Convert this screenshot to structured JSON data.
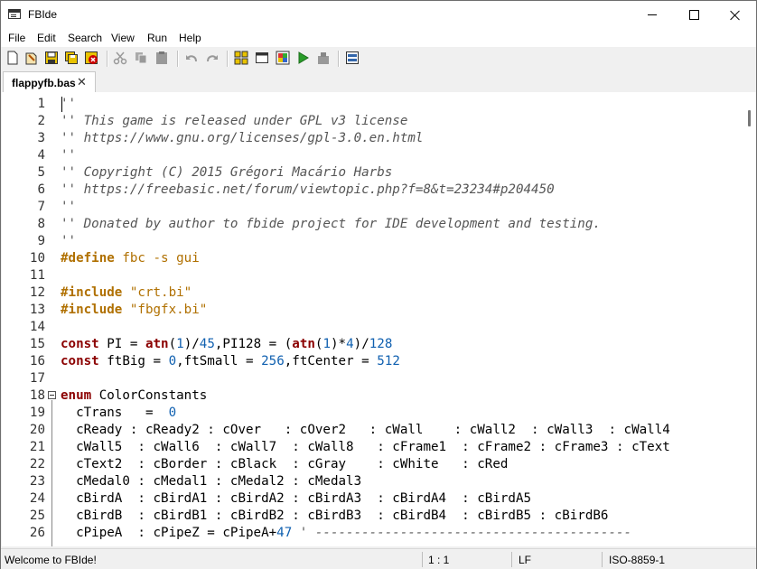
{
  "window": {
    "title": "FBIde"
  },
  "menu": [
    "File",
    "Edit",
    "Search",
    "View",
    "Run",
    "Help"
  ],
  "toolbar": {
    "buttons": [
      {
        "name": "new-file-icon"
      },
      {
        "name": "open-file-icon"
      },
      {
        "name": "save-icon"
      },
      {
        "name": "save-all-icon"
      },
      {
        "name": "close-file-icon"
      },
      {
        "name": "cut-icon"
      },
      {
        "name": "copy-icon"
      },
      {
        "name": "paste-icon"
      },
      {
        "name": "undo-icon"
      },
      {
        "name": "redo-icon"
      },
      {
        "name": "compile-icon"
      },
      {
        "name": "window-icon"
      },
      {
        "name": "compile-run-icon"
      },
      {
        "name": "run-icon"
      },
      {
        "name": "quick-run-icon"
      },
      {
        "name": "output-icon"
      }
    ]
  },
  "tab": {
    "label": "flappyfb.bas",
    "close": "✕"
  },
  "editor": {
    "line_numbers": [
      "1",
      "2",
      "3",
      "4",
      "5",
      "6",
      "7",
      "8",
      "9",
      "10",
      "11",
      "12",
      "13",
      "14",
      "15",
      "16",
      "17",
      "18",
      "19",
      "20",
      "21",
      "22",
      "23",
      "24",
      "25",
      "26"
    ],
    "lines": [
      [
        {
          "t": "cm",
          "v": "''"
        }
      ],
      [
        {
          "t": "cm",
          "v": "'' This game is released under GPL v3 license"
        }
      ],
      [
        {
          "t": "cm",
          "v": "'' https://www.gnu.org/licenses/gpl-3.0.en.html"
        }
      ],
      [
        {
          "t": "cm",
          "v": "''"
        }
      ],
      [
        {
          "t": "cm",
          "v": "'' Copyright (C) 2015 Grégori Macário Harbs"
        }
      ],
      [
        {
          "t": "cm",
          "v": "'' https://freebasic.net/forum/viewtopic.php?f=8&t=23234#p204450"
        }
      ],
      [
        {
          "t": "cm",
          "v": "''"
        }
      ],
      [
        {
          "t": "cm",
          "v": "'' Donated by author to fbide project for IDE development and testing."
        }
      ],
      [
        {
          "t": "cm",
          "v": "''"
        }
      ],
      [
        {
          "t": "pp",
          "v": "#define"
        },
        {
          "t": "ppa",
          "v": " fbc -s gui"
        }
      ],
      [],
      [
        {
          "t": "pp",
          "v": "#include"
        },
        {
          "t": "ppa",
          "v": " "
        },
        {
          "t": "str",
          "v": "\"crt.bi\""
        }
      ],
      [
        {
          "t": "pp",
          "v": "#include"
        },
        {
          "t": "ppa",
          "v": " "
        },
        {
          "t": "str",
          "v": "\"fbgfx.bi\""
        }
      ],
      [],
      [
        {
          "t": "kw",
          "v": "const"
        },
        {
          "t": "",
          "v": " PI = "
        },
        {
          "t": "kw",
          "v": "atn"
        },
        {
          "t": "",
          "v": "("
        },
        {
          "t": "num",
          "v": "1"
        },
        {
          "t": "",
          "v": ")/"
        },
        {
          "t": "num",
          "v": "45"
        },
        {
          "t": "",
          "v": ",PI128 = ("
        },
        {
          "t": "kw",
          "v": "atn"
        },
        {
          "t": "",
          "v": "("
        },
        {
          "t": "num",
          "v": "1"
        },
        {
          "t": "",
          "v": ")*"
        },
        {
          "t": "num",
          "v": "4"
        },
        {
          "t": "",
          "v": ")/"
        },
        {
          "t": "num",
          "v": "128"
        }
      ],
      [
        {
          "t": "kw",
          "v": "const"
        },
        {
          "t": "",
          "v": " ftBig = "
        },
        {
          "t": "num",
          "v": "0"
        },
        {
          "t": "",
          "v": ",ftSmall = "
        },
        {
          "t": "num",
          "v": "256"
        },
        {
          "t": "",
          "v": ",ftCenter = "
        },
        {
          "t": "num",
          "v": "512"
        }
      ],
      [],
      [
        {
          "t": "kw",
          "v": "enum"
        },
        {
          "t": "",
          "v": " ColorConstants"
        }
      ],
      [
        {
          "t": "",
          "v": "  cTrans   =  "
        },
        {
          "t": "num",
          "v": "0"
        }
      ],
      [
        {
          "t": "",
          "v": "  cReady : cReady2 : cOver   : cOver2   : cWall    : cWall2  : cWall3  : cWall4"
        }
      ],
      [
        {
          "t": "",
          "v": "  cWall5  : cWall6  : cWall7  : cWall8   : cFrame1  : cFrame2 : cFrame3 : cText"
        }
      ],
      [
        {
          "t": "",
          "v": "  cText2  : cBorder : cBlack  : cGray    : cWhite   : cRed"
        }
      ],
      [
        {
          "t": "",
          "v": "  cMedal0 : cMedal1 : cMedal2 : cMedal3"
        }
      ],
      [
        {
          "t": "",
          "v": "  cBirdA  : cBirdA1 : cBirdA2 : cBirdA3  : cBirdA4  : cBirdA5"
        }
      ],
      [
        {
          "t": "",
          "v": "  cBirdB  : cBirdB1 : cBirdB2 : cBirdB3  : cBirdB4  : cBirdB5 : cBirdB6"
        }
      ],
      [
        {
          "t": "",
          "v": "  cPipeA  : cPipeZ = cPipeA+"
        },
        {
          "t": "num",
          "v": "47"
        },
        {
          "t": "cm",
          "v": " ' -----------------------------------------"
        }
      ]
    ]
  },
  "status": {
    "message": "Welcome to FBIde!",
    "position": "1 : 1",
    "line_ending": "LF",
    "encoding": "ISO-8859-1"
  }
}
